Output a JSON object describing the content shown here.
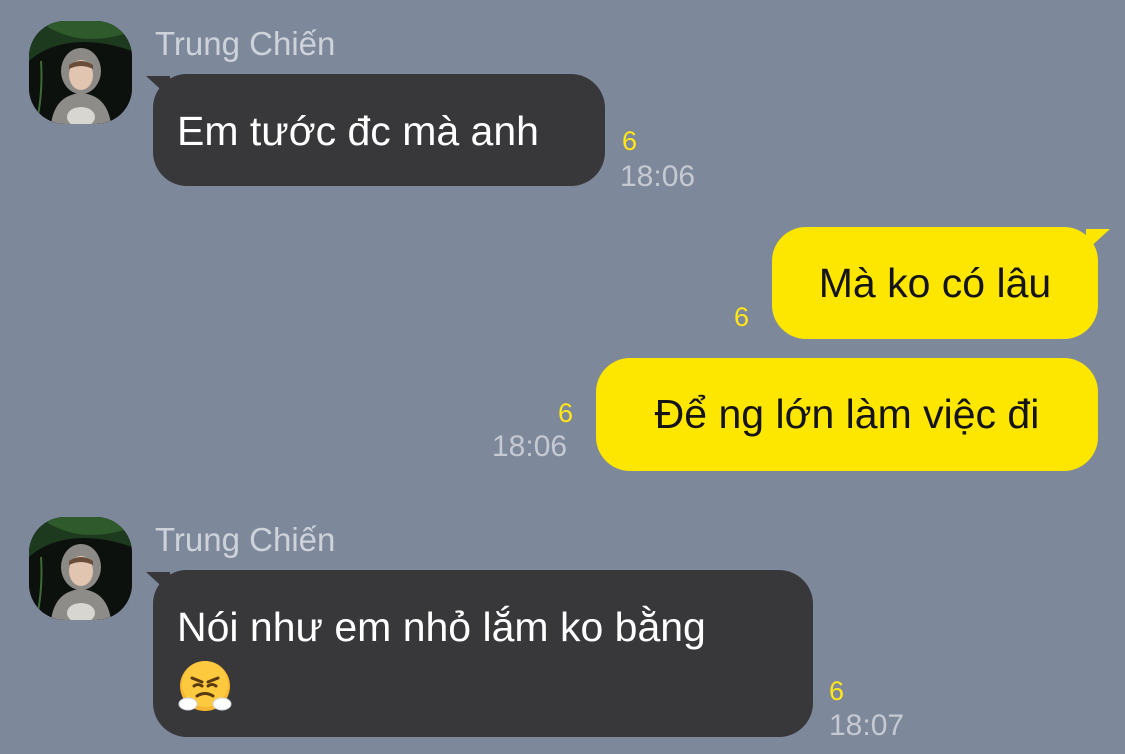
{
  "colors": {
    "background": "#7e889b",
    "incoming_bubble": "#38383b",
    "outgoing_bubble": "#fde600",
    "unread_count": "#ffe617",
    "timestamp": "#c4c9d2",
    "sender_name": "#cdd2db"
  },
  "messages": [
    {
      "sender": "Trung Chiến",
      "text": "Em tước đc mà anh",
      "unread": "6",
      "time": "18:06"
    },
    {
      "text": "Mà ko có lâu",
      "unread": "6"
    },
    {
      "text": "Để ng lớn làm việc đi",
      "unread": "6",
      "time": "18:06"
    },
    {
      "sender": "Trung Chiến",
      "text": "Nói như em nhỏ lắm ko bằng",
      "emoji": "face-with-steam-from-nose-emoji",
      "unread": "6",
      "time": "18:07"
    }
  ]
}
